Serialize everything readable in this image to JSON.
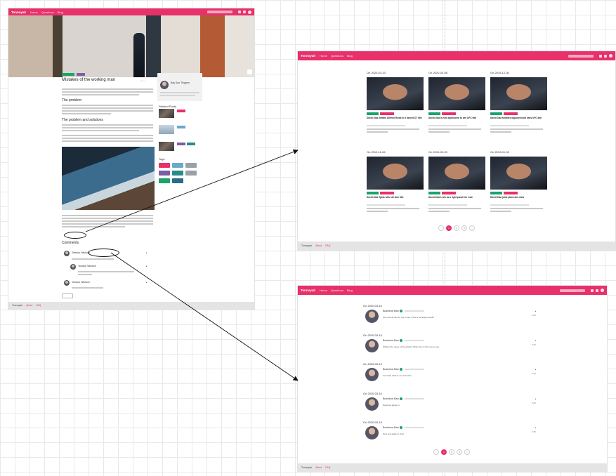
{
  "brand": "Tonnoyah",
  "left_frame": {
    "nav_links": [
      "Home",
      "Questions",
      "Blog"
    ],
    "post_title": "Mistakes of the working man",
    "sec_problem": "The problem",
    "sec_solutions": "The problem and solutions",
    "author_name": "Bay Sun Thigpen",
    "related_title": "Related Posts",
    "tags_title": "Tags",
    "comments_title": "Comments",
    "commenter": "Tamson Wisdom",
    "footer_links": [
      "About",
      "FAQ"
    ]
  },
  "right_top": {
    "nav_links": [
      "Home",
      "Questions",
      "Blog"
    ],
    "cards": [
      {
        "date": "On 2020-03-10",
        "title": "David Diaz defeats Alfredo Rivas in a decent OT title"
      },
      {
        "date": "On 2020-03-08",
        "title": "David Diaz is now sponsored to win UFC title"
      },
      {
        "date": "On 2019-12-30",
        "title": "David Diaz fumbles opponent and wins UFC title"
      },
      {
        "date": "On 2019-11-06",
        "title": "David Diaz fights with old skin title"
      },
      {
        "date": "On 2019-03-20",
        "title": "David Diaz's win as a right punch for now"
      },
      {
        "date": "On 2019-01-02",
        "title": "David Diaz joins plans and wins"
      }
    ],
    "pages": [
      "1",
      "2",
      "3"
    ],
    "footer_links": [
      "About",
      "FAQ"
    ]
  },
  "right_bottom": {
    "nav_links": [
      "Home",
      "Questions",
      "Blog"
    ],
    "entries": [
      {
        "date": "On 2020-03-10",
        "user": "Business Man",
        "text": "Can you do this for me to see if this is working as well?",
        "score": "0.25"
      },
      {
        "date": "On 2020-03-10",
        "user": "Business Man",
        "text": "What is the name of the article? Write this in 3 for you to see.",
        "score": "0.25"
      },
      {
        "date": "On 2020-03-10",
        "user": "Business Man",
        "text": "Just hate what to see how this...",
        "score": "0.25"
      },
      {
        "date": "On 2020-03-10",
        "user": "Business Man",
        "text": "Need we agree to",
        "score": "0.25"
      },
      {
        "date": "On 2020-03-10",
        "user": "Business Man",
        "text": "New test again to start",
        "score": "0.25"
      }
    ],
    "pages": [
      "1",
      "2",
      "3"
    ],
    "footer_links": [
      "About",
      "FAQ"
    ]
  },
  "colors": {
    "accent": "#e8306b",
    "green": "#1aa36a",
    "teal": "#2a8a8a",
    "purple": "#7a5fa6"
  }
}
